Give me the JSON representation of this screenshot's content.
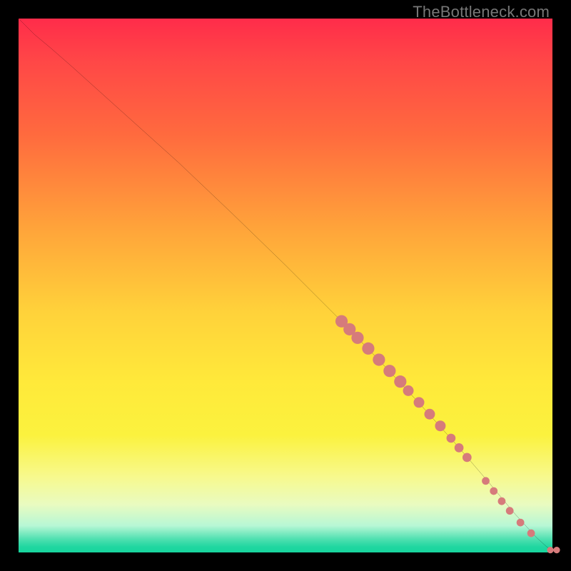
{
  "attribution": "TheBottleneck.com",
  "colors": {
    "page_bg": "#000000",
    "curve": "#000000",
    "marker_fill": "#d67b7b",
    "gradient_top": "#ff2c4a",
    "gradient_mid": "#ffe93a",
    "gradient_bottom": "#18d69e"
  },
  "chart_data": {
    "type": "line",
    "title": "",
    "xlabel": "",
    "ylabel": "",
    "xlim": [
      0,
      100
    ],
    "ylim": [
      0,
      100
    ],
    "grid": false,
    "legend": false,
    "series": [
      {
        "name": "curve",
        "x": [
          0,
          3,
          6,
          10,
          15,
          20,
          30,
          40,
          50,
          60,
          68,
          75,
          82,
          88,
          93,
          97,
          99,
          100
        ],
        "y": [
          100,
          97,
          94.5,
          91,
          86.5,
          82,
          73,
          63.5,
          53.8,
          43.8,
          35.5,
          28,
          20.2,
          13.2,
          7.2,
          2.8,
          1.0,
          0.5
        ]
      },
      {
        "name": "markers_r7",
        "x": [
          60.5,
          62.0,
          63.5,
          65.5,
          67.5,
          69.5,
          71.5
        ],
        "y": [
          43.3,
          41.8,
          40.2,
          38.2,
          36.1,
          34.0,
          32.0
        ]
      },
      {
        "name": "markers_r6",
        "x": [
          73.0,
          75.0,
          77.0,
          79.0
        ],
        "y": [
          30.3,
          28.1,
          25.9,
          23.7
        ]
      },
      {
        "name": "markers_r5",
        "x": [
          81.0,
          82.5,
          84.0
        ],
        "y": [
          21.4,
          19.6,
          17.8
        ]
      },
      {
        "name": "markers_r4",
        "x": [
          87.5,
          89.0,
          90.5,
          92.0,
          94.0,
          96.0
        ],
        "y": [
          13.4,
          11.5,
          9.6,
          7.8,
          5.6,
          3.6
        ]
      },
      {
        "name": "markers_r3",
        "x": [
          99.6,
          100.8
        ],
        "y": [
          0.45,
          0.45
        ]
      }
    ]
  }
}
